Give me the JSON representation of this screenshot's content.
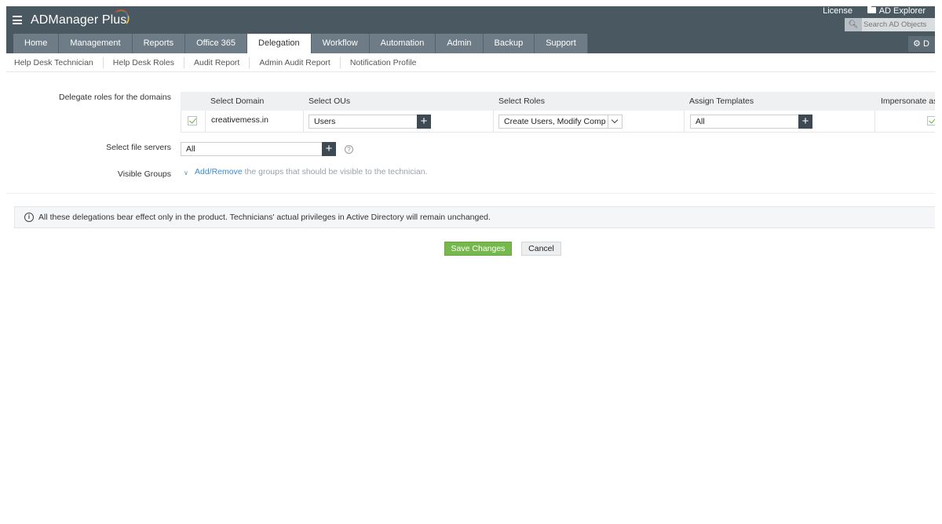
{
  "app": {
    "title": "ADManager Plus"
  },
  "top_links": {
    "license": "License",
    "ad_explorer": "AD Explorer"
  },
  "search": {
    "placeholder": "Search AD Objects"
  },
  "nav": {
    "tabs": [
      {
        "label": "Home"
      },
      {
        "label": "Management"
      },
      {
        "label": "Reports"
      },
      {
        "label": "Office 365"
      },
      {
        "label": "Delegation"
      },
      {
        "label": "Workflow"
      },
      {
        "label": "Automation"
      },
      {
        "label": "Admin"
      },
      {
        "label": "Backup"
      },
      {
        "label": "Support"
      }
    ],
    "active": "Delegation",
    "gear_label": "D"
  },
  "subnav": {
    "items": [
      {
        "label": "Help Desk Technician"
      },
      {
        "label": "Help Desk Roles"
      },
      {
        "label": "Audit Report"
      },
      {
        "label": "Admin Audit Report"
      },
      {
        "label": "Notification Profile"
      }
    ]
  },
  "form": {
    "delegate_label": "Delegate roles for the domains",
    "columns": {
      "domain": "Select Domain",
      "ous": "Select OUs",
      "roles": "Select Roles",
      "templates": "Assign Templates",
      "impersonate": "Impersonate as"
    },
    "row": {
      "domain": "creativemess.in",
      "ous": "Users",
      "roles": "Create Users, Modify Comp",
      "templates": "All"
    },
    "file_servers_label": "Select file servers",
    "file_servers_value": "All",
    "visible_groups_label": "Visible Groups",
    "visible_groups_link": "Add/Remove",
    "visible_groups_text": " the groups that should be visible to the technician."
  },
  "note": {
    "text": "All these delegations bear effect only in the product. Technicians' actual privileges in Active Directory will remain unchanged."
  },
  "actions": {
    "save": "Save Changes",
    "cancel": "Cancel"
  },
  "colors": {
    "header": "#4a5862",
    "tab": "#6d7c86",
    "save": "#76b84c",
    "link": "#3a8dcb",
    "check": "#6cb33e"
  }
}
